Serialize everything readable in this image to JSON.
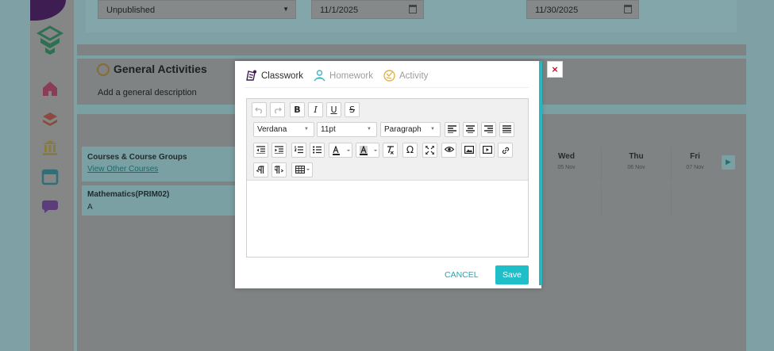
{
  "background": {
    "filters": {
      "status_value": "Unpublished",
      "start_date": "11/1/2025",
      "end_date": "11/30/2025"
    },
    "general_activities": {
      "title": "General Activities",
      "description_placeholder": "Add a general description"
    },
    "schedule": {
      "courses_header": "Courses & Course Groups",
      "view_other_link": "View Other Courses",
      "course_name": "Mathematics(PRIM02)",
      "course_section": "A",
      "days": [
        {
          "name": "Wed",
          "date": "05 Nov"
        },
        {
          "name": "Thu",
          "date": "06 Nov"
        },
        {
          "name": "Fri",
          "date": "07 Nov"
        }
      ]
    },
    "sidebar_icons": [
      "home-icon",
      "book-stack-icon",
      "institution-icon",
      "calendar-icon",
      "chat-icon"
    ]
  },
  "modal": {
    "tabs": [
      {
        "label": "Classwork",
        "icon": "classwork-icon",
        "active": true
      },
      {
        "label": "Homework",
        "icon": "homework-icon",
        "active": false
      },
      {
        "label": "Activity",
        "icon": "activity-icon",
        "active": false
      }
    ],
    "toolbar": {
      "font_family": "Verdana",
      "font_size": "11pt",
      "block_format": "Paragraph",
      "bold": "B",
      "italic": "I",
      "underline": "U",
      "strike": "S",
      "special_char": "Ω"
    },
    "cancel_label": "CANCEL",
    "save_label": "Save",
    "close_label": "×"
  },
  "colors": {
    "accent": "#1fbfc9",
    "close": "#d0021b",
    "classwork_icon": "#3e1d52",
    "homework_icon": "#3fb8c6",
    "activity_icon": "#e2b24a"
  }
}
